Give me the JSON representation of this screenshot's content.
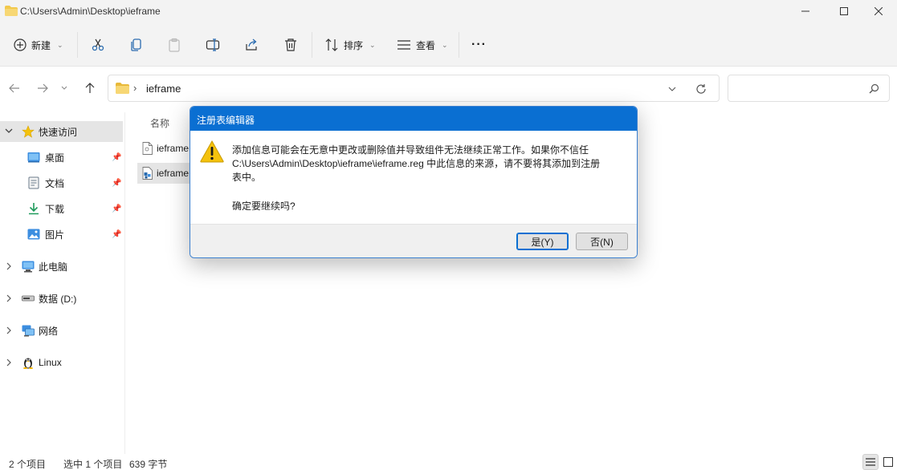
{
  "window": {
    "path_title": "C:\\Users\\Admin\\Desktop\\ieframe"
  },
  "toolbar": {
    "new_label": "新建",
    "sort_label": "排序",
    "view_label": "查看",
    "more_label": "···"
  },
  "address": {
    "separator": "›",
    "crumb": "ieframe",
    "search_placeholder": ""
  },
  "sidebar": {
    "quick_access": "快速访问",
    "items": [
      {
        "label": "桌面",
        "icon": "desktop-icon",
        "pinned": true
      },
      {
        "label": "文档",
        "icon": "documents-icon",
        "pinned": true
      },
      {
        "label": "下载",
        "icon": "download-icon",
        "pinned": true
      },
      {
        "label": "图片",
        "icon": "pictures-icon",
        "pinned": true
      }
    ],
    "this_pc": "此电脑",
    "drive_d": "数据 (D:)",
    "network": "网络",
    "linux": "Linux"
  },
  "filelist": {
    "column_name": "名称",
    "files": [
      {
        "name": "ieframe",
        "icon": "file-icon",
        "selected": false
      },
      {
        "name": "ieframe",
        "icon": "reg-file-icon",
        "selected": true
      }
    ]
  },
  "status": {
    "item_count": "2 个项目",
    "selection": "选中 1 个项目",
    "size": "639 字节"
  },
  "dialog": {
    "title": "注册表编辑器",
    "message_line1": "添加信息可能会在无意中更改或删除值并导致组件无法继续正常工作。如果你不信任",
    "message_line2": "C:\\Users\\Admin\\Desktop\\ieframe\\ieframe.reg 中此信息的来源，请不要将其添加到注册",
    "message_line3": "表中。",
    "question": "确定要继续吗?",
    "yes_label": "是(Y)",
    "no_label": "否(N)"
  },
  "colors": {
    "dialog_title_bg": "#0a6fd2",
    "warning_yellow": "#f4c20d",
    "folder_yellow": "#f2c94c",
    "selection_gray": "#e5e5e5"
  }
}
